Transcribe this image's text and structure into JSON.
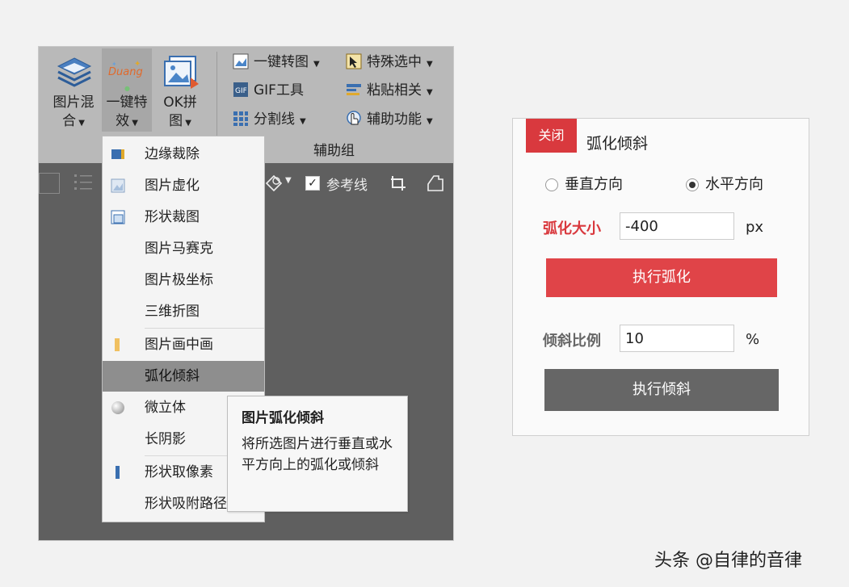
{
  "ribbon": {
    "big_buttons": [
      {
        "line1": "图片混",
        "line2": "合"
      },
      {
        "line1": "一键特",
        "line2": "效"
      },
      {
        "line1": "OK拼",
        "line2": "图"
      }
    ],
    "duang_text": "Duang",
    "small_buttons": [
      {
        "label": "一键转图",
        "icon": "convert-icon"
      },
      {
        "label": "GIF工具",
        "icon": "gif-icon"
      },
      {
        "label": "分割线",
        "icon": "grid-icon"
      },
      {
        "label": "特殊选中",
        "icon": "select-icon"
      },
      {
        "label": "粘贴相关",
        "icon": "paste-icon"
      },
      {
        "label": "辅助功能",
        "icon": "assist-icon"
      }
    ],
    "group_label": "辅助组"
  },
  "toolbar2": {
    "guide_label": "参考线"
  },
  "menu": {
    "items": [
      {
        "label": "边缘裁除",
        "icon": "crop-icon"
      },
      {
        "label": "图片虚化",
        "icon": "blur-icon"
      },
      {
        "label": "形状裁图",
        "icon": "shape-crop-icon"
      },
      {
        "label": "图片马赛克",
        "icon": ""
      },
      {
        "label": "图片极坐标",
        "icon": ""
      },
      {
        "label": "三维折图",
        "icon": ""
      },
      {
        "label": "图片画中画",
        "icon": "pip-icon"
      },
      {
        "label": "弧化倾斜",
        "icon": ""
      },
      {
        "label": "微立体",
        "icon": "sphere-icon"
      },
      {
        "label": "长阴影",
        "icon": ""
      },
      {
        "label": "形状取像素",
        "icon": "pixel-icon"
      },
      {
        "label": "形状吸附路径",
        "icon": ""
      }
    ]
  },
  "tooltip": {
    "title": "图片弧化倾斜",
    "body": "将所选图片进行垂直或水平方向上的弧化或倾斜"
  },
  "panel": {
    "close_label": "关闭",
    "title": "弧化倾斜",
    "radio_vertical": "垂直方向",
    "radio_horizontal": "水平方向",
    "selected_direction": "水平方向",
    "arc_label": "弧化大小",
    "arc_value": "-400",
    "arc_unit": "px",
    "arc_button": "执行弧化",
    "tilt_label": "倾斜比例",
    "tilt_value": "10",
    "tilt_unit": "%",
    "tilt_button": "执行倾斜"
  },
  "watermark": "头条 @自律的音律",
  "colors": {
    "accent_red": "#d9393e",
    "button_red": "#e04448",
    "button_gray": "#666666",
    "label_red": "#d9393e",
    "ribbon_bg": "#b9b9b9",
    "canvas_bg": "#5f5f5f",
    "menu_hover": "#8e8e8e"
  }
}
